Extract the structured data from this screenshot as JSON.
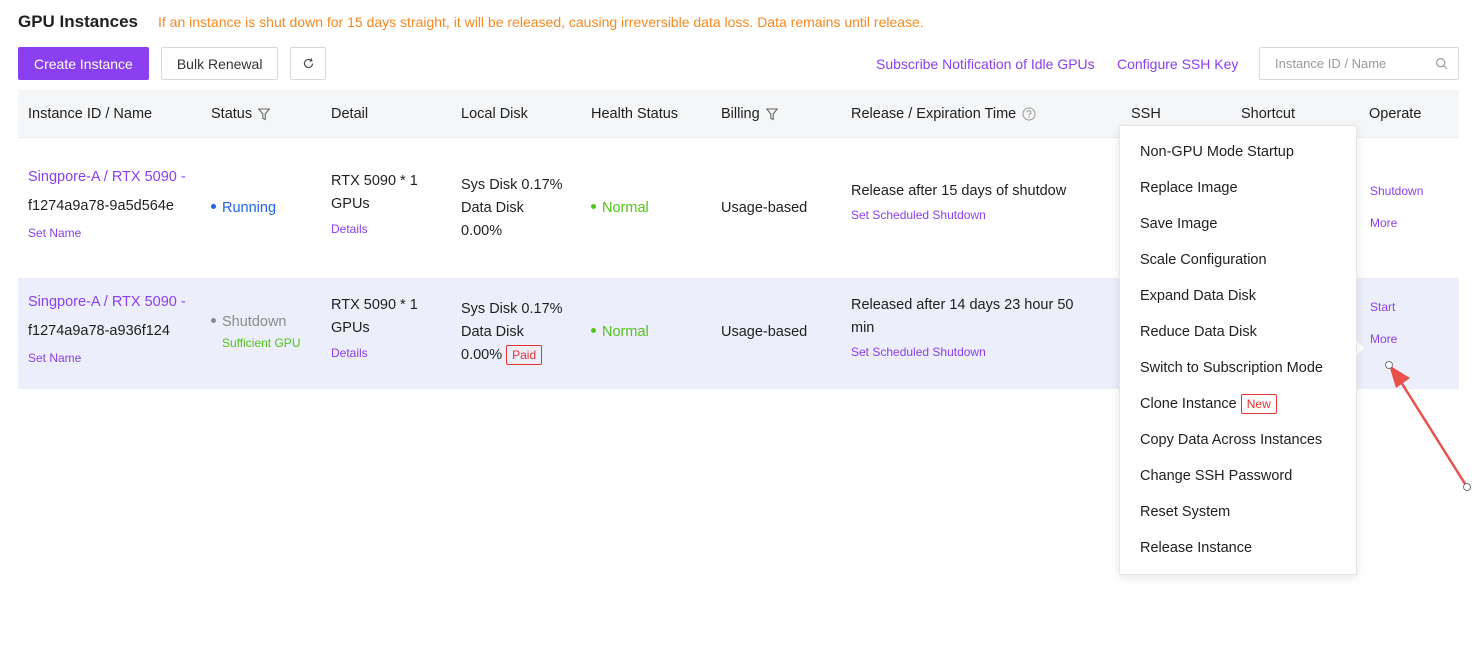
{
  "page": {
    "title": "GPU Instances",
    "warning": "If an instance is shut down for 15 days straight, it will be released, causing irreversible data loss. Data remains until release."
  },
  "toolbar": {
    "create_label": "Create Instance",
    "bulk_label": "Bulk Renewal",
    "refresh_icon": "refresh-icon",
    "subscribe_label": "Subscribe Notification of Idle GPUs",
    "ssh_key_label": "Configure SSH Key",
    "search_placeholder": "Instance ID / Name",
    "search_value": ""
  },
  "table": {
    "columns": {
      "instance": "Instance ID / Name",
      "status": "Status",
      "detail": "Detail",
      "disk": "Local Disk",
      "health": "Health Status",
      "billing": "Billing",
      "release": "Release / Expiration Time",
      "ssh": "SSH",
      "shortcut": "Shortcut",
      "operate": "Operate"
    },
    "rows": [
      {
        "name": "Singpore-A / RTX 5090 -",
        "id": "f1274a9a78-9a5d564e",
        "set_name": "Set Name",
        "status": "Running",
        "status_sub": "",
        "gpu": "RTX 5090 * 1",
        "gpu_unit": "GPUs",
        "details_link": "Details",
        "sys_disk": "Sys Disk 0.17%",
        "data_disk_label": "Data Disk",
        "data_disk_value": "0.00%",
        "paid_tag": "",
        "health": "Normal",
        "billing": "Usage-based",
        "release_line1": "Release after 15 days of shutdow",
        "release_line2": "",
        "scheduled_link": "Set Scheduled Shutdown",
        "op_primary": "Shutdown",
        "op_more": "More"
      },
      {
        "name": "Singpore-A / RTX 5090 -",
        "id": "f1274a9a78-a936f124",
        "set_name": "Set Name",
        "status": "Shutdown",
        "status_sub": "Sufficient GPU",
        "gpu": "RTX 5090 * 1",
        "gpu_unit": "GPUs",
        "details_link": "Details",
        "sys_disk": "Sys Disk 0.17%",
        "data_disk_label": "Data Disk",
        "data_disk_value": "0.00%",
        "paid_tag": "Paid",
        "health": "Normal",
        "billing": "Usage-based",
        "release_line1": "Released after 14 days 23 hour 50",
        "release_line2": "min",
        "scheduled_link": "Set Scheduled Shutdown",
        "op_primary": "Start",
        "op_more": "More"
      }
    ]
  },
  "more_menu": {
    "items": [
      "Non-GPU Mode Startup",
      "Replace Image",
      "Save Image",
      "Scale Configuration",
      "Expand Data Disk",
      "Reduce Data Disk",
      "Switch to Subscription Mode",
      "Clone Instance",
      "Copy Data Across Instances",
      "Change SSH Password",
      "Reset System",
      "Release Instance"
    ],
    "new_tag": "New"
  },
  "colors": {
    "accent": "#8a3ff0",
    "warning": "#f7881f",
    "running": "#2162e8",
    "normal": "#52c41a",
    "danger": "#e3342f",
    "arrow": "#e8504b"
  }
}
